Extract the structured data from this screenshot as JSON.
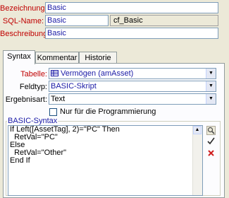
{
  "form": {
    "bezeichnung_label": "Bezeichnung:",
    "bezeichnung_value": "Basic",
    "sqlname_label": "SQL-Name:",
    "sqlname_value": "Basic",
    "sqlname_full": "cf_Basic",
    "beschreibung_label": "Beschreibung:",
    "beschreibung_value": "Basic"
  },
  "tabs": [
    {
      "label": "Syntax"
    },
    {
      "label": "Kommentar"
    },
    {
      "label": "Historie"
    }
  ],
  "syntax": {
    "tabelle_label": "Tabelle:",
    "tabelle_value": "Vermögen (amAsset)",
    "feldtyp_label": "Feldtyp:",
    "feldtyp_value": "BASIC-Skript",
    "ergebnisart_label": "Ergebnisart:",
    "ergebnisart_value": "Text",
    "nur_prog_label": "Nur für die Programmierung",
    "group_title": "BASIC-Syntax",
    "code_lines": [
      "If Left([AssetTag], 2)=\"PC\" Then",
      "  RetVal=\"PC\"",
      "Else",
      "  RetVal=\"Other\"",
      "End If"
    ]
  },
  "icons": {
    "arrow": "arrow-up-icon",
    "search": "magnifier-icon",
    "check": "checkmark-icon",
    "delete": "x-icon"
  }
}
